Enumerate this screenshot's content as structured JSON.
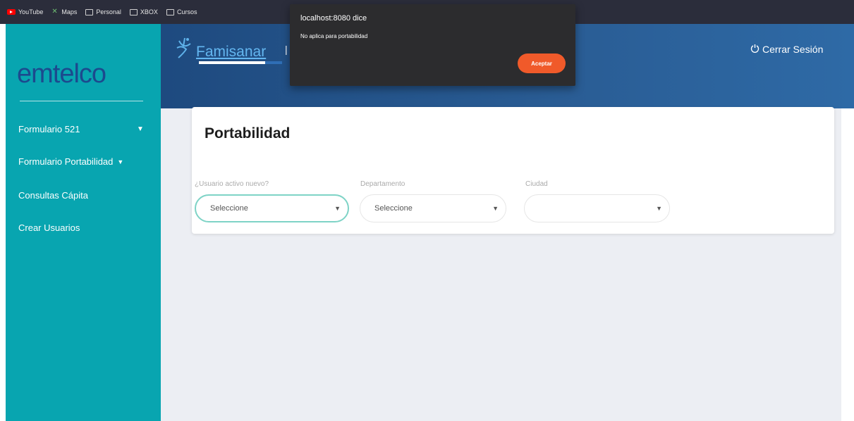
{
  "bookmarks": [
    {
      "label": "YouTube",
      "icon": "youtube-icon"
    },
    {
      "label": "Maps",
      "icon": "maps-icon"
    },
    {
      "label": "Personal",
      "icon": "folder-icon"
    },
    {
      "label": "XBOX",
      "icon": "folder-icon"
    },
    {
      "label": "Cursos",
      "icon": "folder-icon"
    }
  ],
  "sidebar": {
    "logo": "emtelco",
    "items": [
      {
        "label": "Formulario 521"
      },
      {
        "label": "Formulario Portabilidad"
      },
      {
        "label": "Consultas Cápita"
      },
      {
        "label": "Crear Usuarios"
      }
    ]
  },
  "header": {
    "brand": "Famisanar",
    "logout_label": "Cerrar Sesión"
  },
  "main": {
    "title": "Portabilidad",
    "fields": [
      {
        "label": "¿Usuario activo nuevo?",
        "value": "Seleccione"
      },
      {
        "label": "Departamento",
        "value": "Seleccione"
      },
      {
        "label": "Ciudad",
        "value": ""
      }
    ]
  },
  "dialog": {
    "title": "localhost:8080 dice",
    "message": "No aplica para portabilidad",
    "button": "Aceptar"
  },
  "colors": {
    "sidebar": "#08a5b0",
    "header": "#1e4a7f",
    "accent_button": "#f05a2a",
    "active_border": "#7ed3c6"
  }
}
